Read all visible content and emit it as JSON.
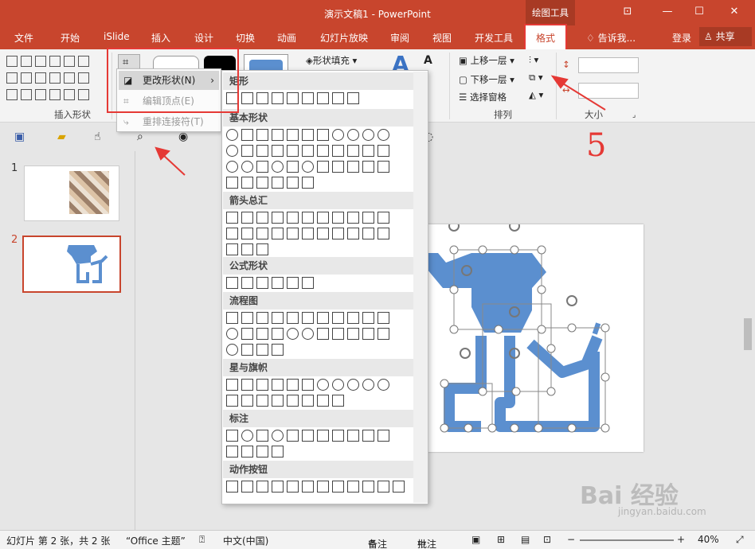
{
  "window": {
    "title": "演示文稿1 - PowerPoint",
    "context_tool": "绘图工具"
  },
  "menu": {
    "tabs": [
      "文件",
      "开始",
      "iSlide",
      "插入",
      "设计",
      "切换",
      "动画",
      "幻灯片放映",
      "审阅",
      "视图",
      "开发工具"
    ],
    "format_tab": "格式",
    "tell_me": "告诉我...",
    "login": "登录",
    "share": "共享"
  },
  "ribbon": {
    "insert_shapes_label": "插入形状",
    "shape_fill": "形状填充",
    "arrange_label": "排列",
    "size_label": "大小",
    "bring_forward": "上移一层",
    "send_backward": "下移一层",
    "selection_pane": "选择窗格"
  },
  "edit_shape_menu": {
    "change_shape": "更改形状(N)",
    "edit_points": "编辑顶点(E)",
    "reroute": "重排连接符(T)"
  },
  "shape_panel": {
    "categories": [
      "矩形",
      "基本形状",
      "箭头总汇",
      "公式形状",
      "流程图",
      "星与旗帜",
      "标注",
      "动作按钮"
    ]
  },
  "slides": {
    "numbers": [
      "1",
      "2"
    ]
  },
  "annotation": {
    "number": "5"
  },
  "status_bar": {
    "slide_info": "幻灯片 第 2 张，共 2 张",
    "theme": "“Office 主题”",
    "language": "中文(中国)",
    "notes": "备注",
    "comments": "批注",
    "zoom": "40%"
  },
  "watermark": {
    "text": "Bai 经验",
    "sub": "jingyan.baidu.com"
  },
  "colors": {
    "accent": "#c8452d",
    "shape_blue": "#5b8fcf",
    "highlight": "#e53935"
  }
}
